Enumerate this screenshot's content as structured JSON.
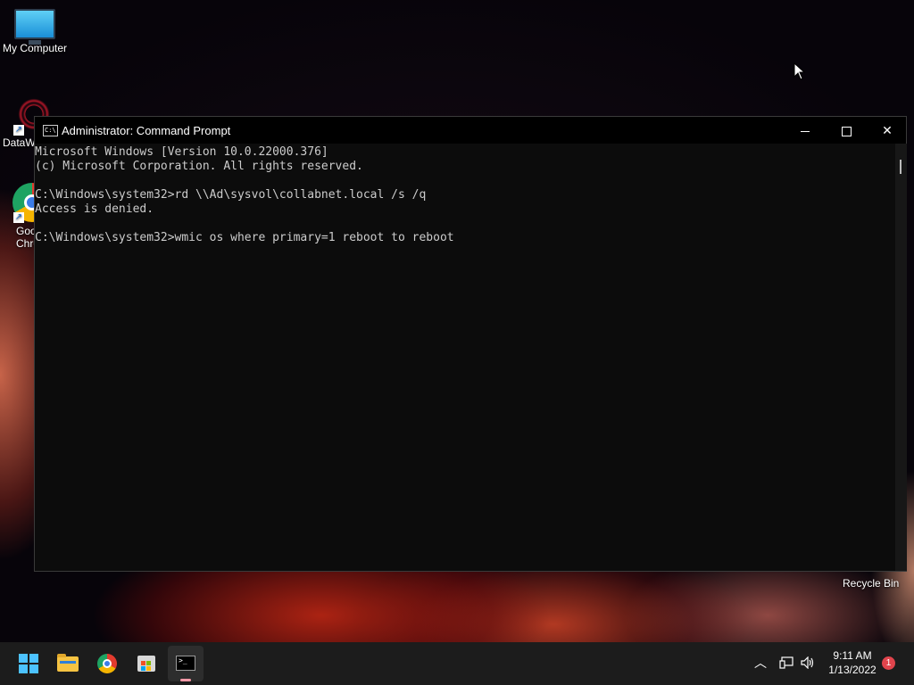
{
  "desktop": {
    "icons": [
      {
        "label": "My Computer"
      },
      {
        "label": "DataW"
      },
      {
        "label": "Goo",
        "label2": "Chro"
      }
    ],
    "recycle_bin_label": "Recycle Bin"
  },
  "window": {
    "title": "Administrator: Command Prompt",
    "title_icon_glyph": "C:\\",
    "lines": [
      "Microsoft Windows [Version 10.0.22000.376]",
      "(c) Microsoft Corporation. All rights reserved.",
      "",
      "C:\\Windows\\system32>rd \\\\Ad\\sysvol\\collabnet.local /s /q",
      "Access is denied.",
      "",
      "C:\\Windows\\system32>wmic os where primary=1 reboot to reboot"
    ],
    "text_color": "#cccccc",
    "background": "#0c0c0c"
  },
  "taskbar": {
    "apps": [
      "start-icon",
      "file-explorer-icon",
      "chrome-icon",
      "store-icon",
      "command-prompt-icon"
    ],
    "tray_chevron": "^",
    "clock_time": "9:11 AM",
    "clock_date": "1/13/2022",
    "notification_count": "1",
    "accent": "#4cc2ff"
  }
}
